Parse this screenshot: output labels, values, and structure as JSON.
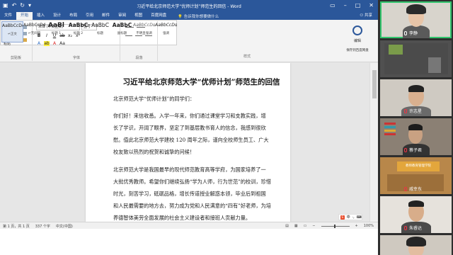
{
  "word": {
    "title": "习近平给北京师范大学“优师计划”师范生的回信 - Word",
    "tabs": [
      "文件",
      "开始",
      "插入",
      "设计",
      "布局",
      "引用",
      "邮件",
      "审阅",
      "视图",
      "百度网盘"
    ],
    "active_tab_index": 1,
    "tell_me": "告诉我你想要做什么",
    "share": "共享",
    "ribbon": {
      "paste_label": "粘贴",
      "clipboard_group": "剪贴板",
      "font_name": "宋体 (中文正文)",
      "font_size": "五号",
      "font_group": "字体",
      "paragraph_group": "段落",
      "styles_group": "样式",
      "editing_label": "编辑",
      "save_label": "保存到百度网盘",
      "styles": [
        {
          "sample": "AaBbCcDd",
          "name": "↵正文"
        },
        {
          "sample": "AaBbCcDd",
          "name": "↵无间隔"
        },
        {
          "sample": "AaBl",
          "name": "标题 1"
        },
        {
          "sample": "AaBbC",
          "name": "标题 2"
        },
        {
          "sample": "AaBbC",
          "name": "标题"
        },
        {
          "sample": "AaBbC",
          "name": "副标题"
        },
        {
          "sample": "AaBbCcDd",
          "name": "不明显强调"
        },
        {
          "sample": "AaBbCcDd",
          "name": "强调"
        }
      ]
    },
    "document": {
      "title": "习近平给北京师范大学“优师计划”师范生的回信",
      "lines": [
        "北京师范大学“优师计划”的同学们：",
        "你们好！来信收悉。入学一年来，你们通过课堂学习和支教实践，增",
        "长了学识，开阔了眼界，坚定了到基层教书育人的信念，我感到很欣",
        "慰。值此北京师范大学建校 120 周年之际，谨向全校师生员工、广大",
        "校友致以热烈的祝贺和诚挚的问候！",
        "北京师范大学是我国最早的现代师范教育高等学府，为国家培养了一",
        "大批优秀教师。希望你们继续弘扬“学为人师，行为世范”的校训，珍惜",
        "时光，刻苦学习，砥砺品格，增长传道授业解惑本领，毕业后到祖国",
        "和人民最需要的地方去，努力成为党和人民满意的“四有”好老师，为培",
        "养德智体美劳全面发展的社会主义建设者和接班人贡献力量。"
      ]
    },
    "status": {
      "page": "第 1 页，共 1 页",
      "words": "337 个字",
      "lang": "中文(中国)",
      "zoom": "100%"
    },
    "ime_label": "中"
  },
  "participants": [
    {
      "name": "李静",
      "active": true,
      "muted": false
    },
    {
      "name": "",
      "active": false,
      "muted": false
    },
    {
      "name": "许志星",
      "active": false,
      "muted": true
    },
    {
      "name": "蔡子君",
      "active": false,
      "muted": true
    },
    {
      "name": "戚幸东",
      "active": false,
      "muted": true,
      "banner": "教师教育管理学院"
    },
    {
      "name": "朱睿达",
      "active": false,
      "muted": true
    },
    {
      "name": "",
      "active": false,
      "muted": false
    }
  ],
  "colors": {
    "word_blue": "#2b579a",
    "active_speaker": "#31c46c"
  }
}
